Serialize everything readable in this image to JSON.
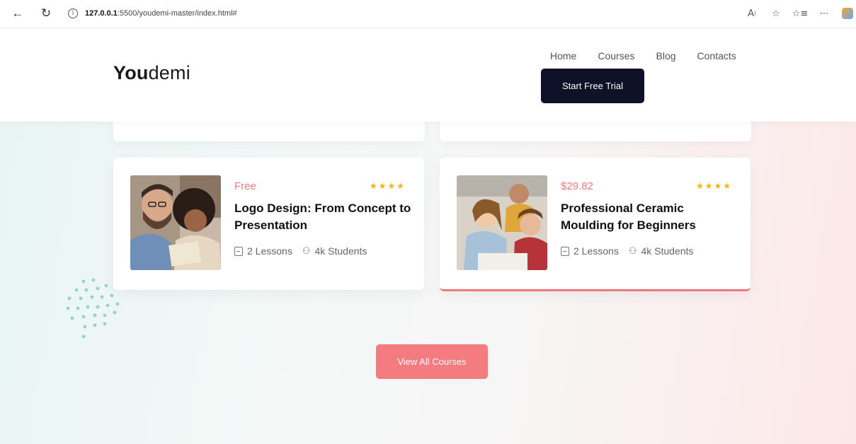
{
  "browser": {
    "url_host": "127.0.0.1",
    "url_rest": ":5500/youdemi-master/index.html#"
  },
  "header": {
    "logo_bold": "You",
    "logo_light": "demi",
    "nav": [
      "Home",
      "Courses",
      "Blog",
      "Contacts"
    ],
    "cta_label": "Start Free Trial"
  },
  "courses": [
    {
      "price": "Free",
      "stars": "★★★★",
      "title": "Logo Design: From Concept to Presentation",
      "lessons": "2 Lessons",
      "students": "4k Students"
    },
    {
      "price": "$29.82",
      "stars": "★★★★",
      "title": "Professional Ceramic Moulding for Beginners",
      "lessons": "2 Lessons",
      "students": "4k Students"
    }
  ],
  "view_all_label": "View All Courses",
  "colors": {
    "accent": "#f47b7f",
    "dark": "#0f1129",
    "star": "#f6b21b",
    "dots": "#8fd6c8"
  },
  "icons": {
    "back": "back-arrow-icon",
    "refresh": "refresh-icon",
    "info": "info-icon",
    "read_aloud": "read-aloud-icon",
    "favorite": "star-outline-icon",
    "favorites_bar": "favorites-icon",
    "more": "ellipsis-icon",
    "lessons": "lesson-icon",
    "students": "students-icon"
  }
}
